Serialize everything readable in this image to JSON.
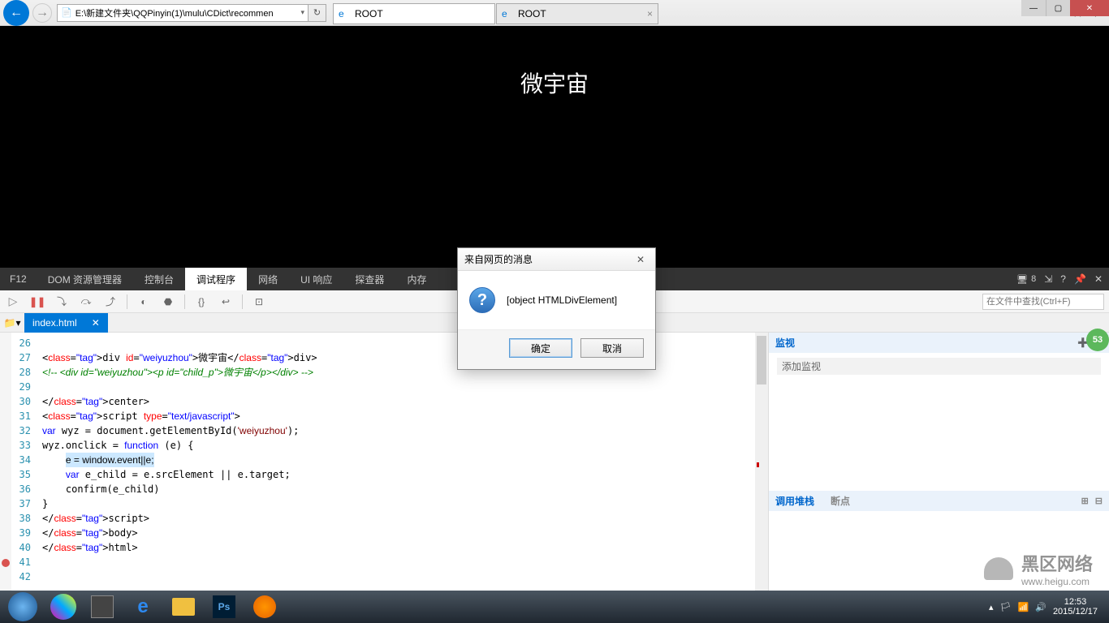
{
  "window": {
    "min": "—",
    "max": "▢",
    "close": "✕"
  },
  "browser": {
    "address": "E:\\新建文件夹\\QQPinyin(1)\\mulu\\CDict\\recommen",
    "tabs": [
      {
        "title": "ROOT",
        "active": true
      },
      {
        "title": "ROOT",
        "active": false
      }
    ],
    "icons": {
      "home": "⌂",
      "star": "☆",
      "gear": "✳"
    }
  },
  "page": {
    "heading": "微宇宙"
  },
  "devtools": {
    "f12": "F12",
    "tabs": [
      "DOM 资源管理器",
      "控制台",
      "调试程序",
      "网络",
      "UI 响应",
      "探查器",
      "内存"
    ],
    "active_tab": "调试程序",
    "right": {
      "screens": "8"
    },
    "search_placeholder": "在文件中查找(Ctrl+F)",
    "file_tab": "index.html",
    "line_start": 26,
    "code_lines": [
      "",
      "<div id=\"weiyuzhou\">微宇宙</div>",
      "<!-- <div id=\"weiyuzhou\"><p id=\"child_p\">微宇宙</p></div> -->",
      "",
      "</center>",
      "<script type=\"text/javascript\">",
      "var wyz = document.getElementById('weiyuzhou');",
      "wyz.onclick = function (e) {",
      "    e = window.event||e;",
      "    var e_child = e.srcElement || e.target;",
      "    confirm(e_child)",
      "}",
      "</script>",
      "</body>",
      "</html>",
      "",
      ""
    ],
    "watch": {
      "header": "监视",
      "add": "添加监视"
    },
    "callstack": {
      "header": "调用堆栈",
      "breakpoints": "断点"
    }
  },
  "dialog": {
    "title": "来自网页的消息",
    "message": "[object HTMLDivElement]",
    "ok": "确定",
    "cancel": "取消"
  },
  "badge": "53",
  "taskbar": {
    "time": "12:53",
    "date": "2015/12/17"
  },
  "watermark": {
    "line1": "黑区网络",
    "line2": "www.heigu.com"
  }
}
